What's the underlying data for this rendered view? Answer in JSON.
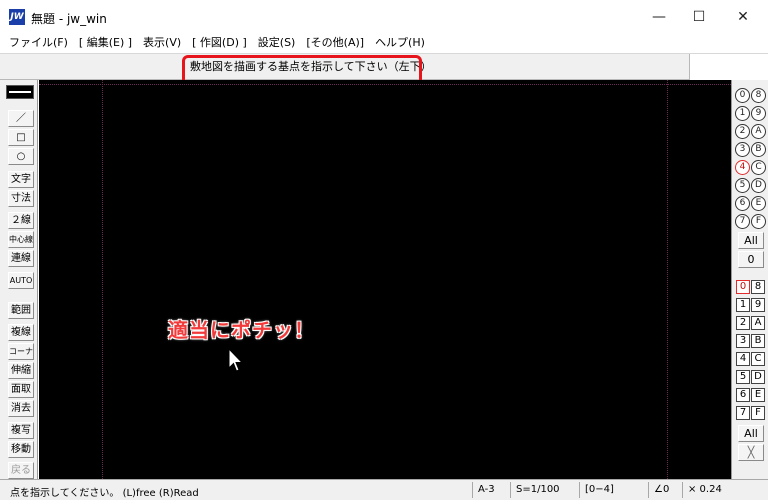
{
  "window": {
    "app_icon_text": "JW",
    "title": "無題 - jw_win",
    "minimize": "—",
    "maximize": "☐",
    "close": "✕"
  },
  "menu": [
    "ファイル(F)",
    "[ 編集(E) ]",
    "表示(V)",
    "[ 作図(D) ]",
    "設定(S)",
    "[その他(A)]",
    "ヘルプ(H)"
  ],
  "prompt": {
    "text": "敷地図を描画する基点を指示して下さい（左下）"
  },
  "left_tools": [
    {
      "label": "／"
    },
    {
      "label": "□"
    },
    {
      "label": "○"
    },
    {
      "label": "文字"
    },
    {
      "label": "寸法"
    },
    {
      "label": "２線"
    },
    {
      "label": "中心線"
    },
    {
      "label": "連線"
    },
    {
      "label": "AUTO"
    },
    {
      "label": "範囲"
    },
    {
      "label": "複線"
    },
    {
      "label": "コーナー"
    },
    {
      "label": "伸縮"
    },
    {
      "label": "面取"
    },
    {
      "label": "消去"
    },
    {
      "label": "複写"
    },
    {
      "label": "移動"
    },
    {
      "label": "戻る"
    }
  ],
  "layer_groups": {
    "rows": [
      [
        "0",
        "8"
      ],
      [
        "1",
        "9"
      ],
      [
        "2",
        "A"
      ],
      [
        "3",
        "B"
      ],
      [
        "4",
        "C"
      ],
      [
        "5",
        "D"
      ],
      [
        "6",
        "E"
      ],
      [
        "7",
        "F"
      ]
    ],
    "all_label": "All",
    "zero_label": "0"
  },
  "layers": {
    "rows": [
      [
        "0",
        "8"
      ],
      [
        "1",
        "9"
      ],
      [
        "2",
        "A"
      ],
      [
        "3",
        "B"
      ],
      [
        "4",
        "C"
      ],
      [
        "5",
        "D"
      ],
      [
        "6",
        "E"
      ],
      [
        "7",
        "F"
      ]
    ],
    "all_label": "All",
    "cross_label": "╳"
  },
  "annotation": "適当にポチッ！",
  "status": {
    "message": "点を指示してください。  (L)free  (R)Read",
    "paper": "A-3",
    "scale": "S=1/100",
    "layer": "[0−4]",
    "angle": "∠0",
    "magnification": "× 0.24"
  },
  "colors": {
    "canvas": "#000000",
    "highlight": "#e8141c",
    "annotation": "#f23a3a"
  }
}
